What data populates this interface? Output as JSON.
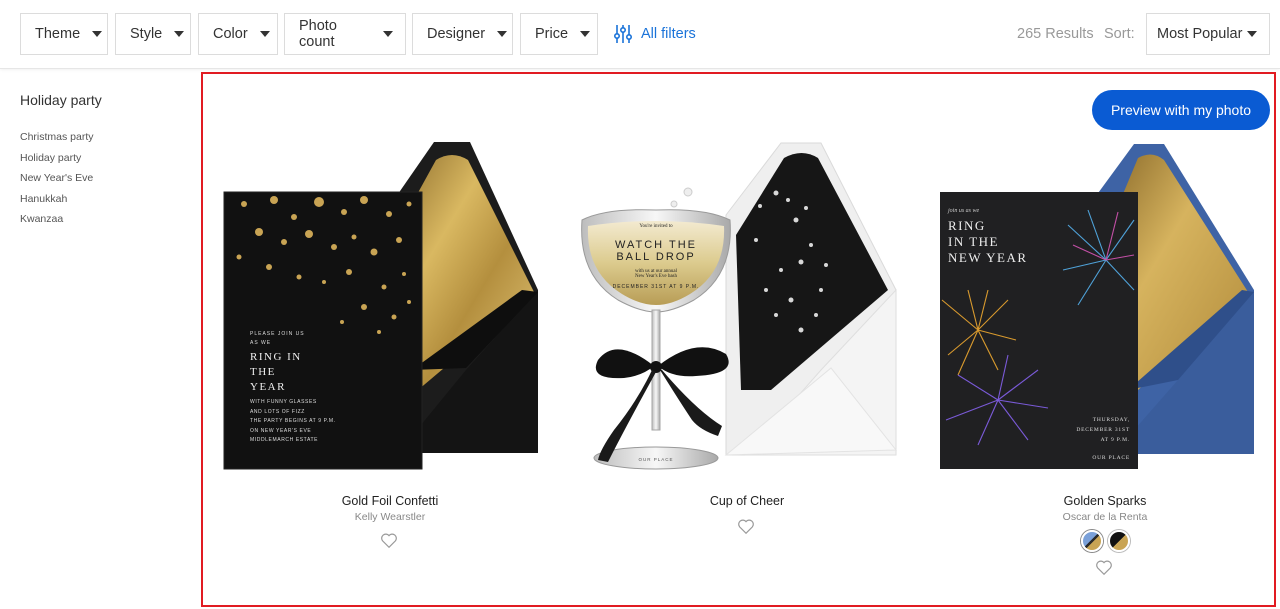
{
  "filters": [
    {
      "label": "Theme"
    },
    {
      "label": "Style"
    },
    {
      "label": "Color"
    },
    {
      "label": "Photo count"
    },
    {
      "label": "Designer"
    },
    {
      "label": "Price"
    }
  ],
  "all_filters_label": "All filters",
  "results_text": "265 Results",
  "sort": {
    "label": "Sort:",
    "value": "Most Popular"
  },
  "sidebar": {
    "title": "Holiday party",
    "items": [
      "Christmas party",
      "Holiday party",
      "New Year's Eve",
      "Hanukkah",
      "Kwanzaa"
    ]
  },
  "preview_button": "Preview with my photo",
  "products": [
    {
      "title": "Gold Foil Confetti",
      "designer": "Kelly Wearstler",
      "card_text": {
        "small_top": [
          "PLEASE JOIN US",
          "AS WE"
        ],
        "big": [
          "RING IN",
          "THE",
          "YEAR"
        ],
        "small_bottom": [
          "WITH FUNNY GLASSES",
          "AND LOTS OF FIZZ",
          "THE PARTY BEGINS AT 9 P.M.",
          "ON NEW YEAR'S EVE",
          "MIDDLEMARCH ESTATE"
        ]
      }
    },
    {
      "title": "Cup of Cheer",
      "designer": "",
      "card_text": {
        "invite": "You're invited to",
        "big": [
          "WATCH THE",
          "BALL DROP"
        ],
        "line1": "with us at our annual",
        "line2": "New Year's Eve bash",
        "date": "DECEMBER 31ST AT 9 P.M.",
        "place": "OUR PLACE"
      }
    },
    {
      "title": "Golden Sparks",
      "designer": "Oscar de la Renta",
      "card_text": {
        "small_top": "join us as we",
        "big": [
          "RING",
          "IN THE",
          "NEW YEAR"
        ],
        "date": [
          "THURSDAY,",
          "DECEMBER 31ST",
          "AT 9 P.M."
        ],
        "place": "OUR PLACE"
      },
      "swatches": [
        "blue-gold",
        "black-gold"
      ]
    }
  ],
  "colors": {
    "accent": "#1a73d9",
    "button": "#0a5bd3",
    "highlight": "#e11b22"
  }
}
